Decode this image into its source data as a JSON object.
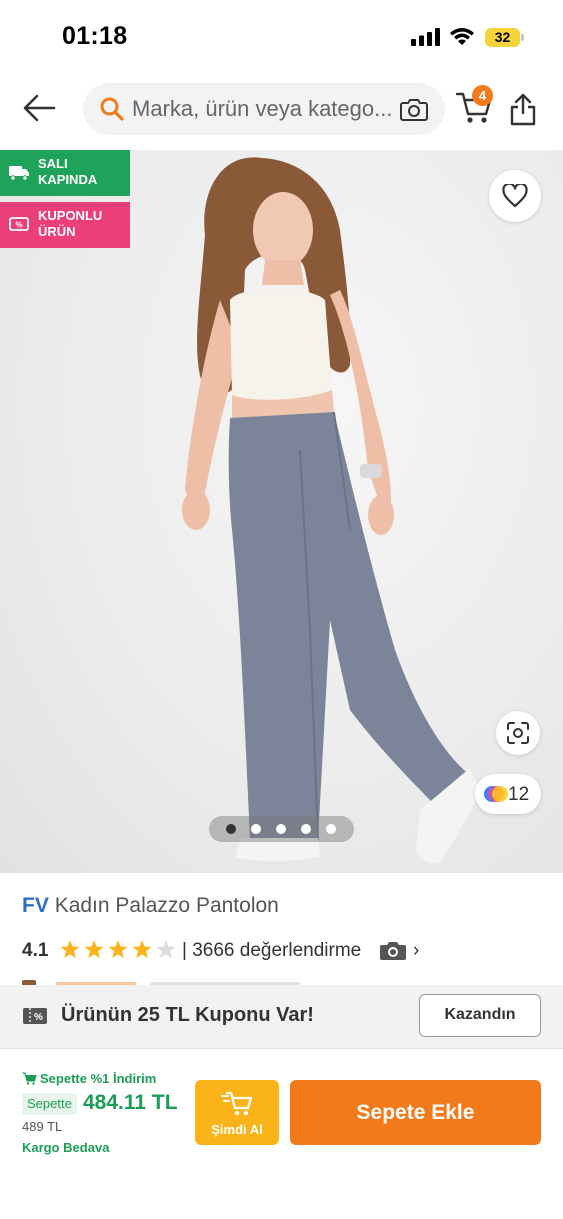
{
  "status_bar": {
    "time": "01:18",
    "battery": "32"
  },
  "header": {
    "search_placeholder": "Marka, ürün veya katego...",
    "cart_count": "4"
  },
  "image": {
    "badges": [
      {
        "line1": "SALI",
        "line2": "KAPINDA",
        "color": "#1fa25a"
      },
      {
        "line1": "KUPONLU",
        "line2": "ÜRÜN",
        "color": "#ec3f78"
      }
    ],
    "color_count": "12",
    "pager": {
      "total": 5,
      "active": 0
    }
  },
  "product": {
    "brand": "FV",
    "name": "Kadın Palazzo Pantolon",
    "rating": "4.1",
    "stars": 4,
    "review_count": "| 3666 değerlendirme",
    "more": "›"
  },
  "coupon": {
    "text": "Ürünün 25 TL Kuponu Var!",
    "button": "Kazandın"
  },
  "purchase": {
    "discount_note": "Sepette %1 İndirim",
    "cart_tag": "Sepette",
    "cart_price": "484.11 TL",
    "old_price": "489 TL",
    "shipping": "Kargo Bedava",
    "buy_now": "Şimdi Al",
    "add_to_cart": "Sepete Ekle"
  },
  "colors": {
    "accent": "#f27a1a",
    "green": "#1c9d55",
    "pink": "#ec3f78",
    "star": "#fbb31a",
    "brand": "#2d6fc7"
  }
}
